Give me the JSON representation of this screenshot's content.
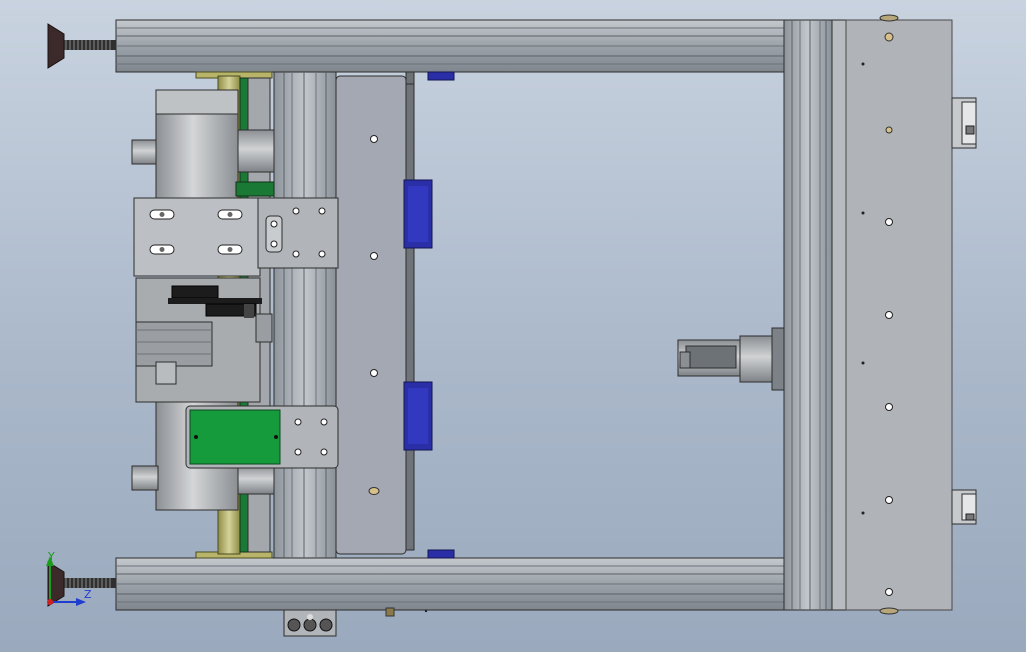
{
  "window": {
    "title": ""
  },
  "viewport": {
    "background_top": "#c9d3e0",
    "background_bottom": "#9aa9bd"
  },
  "triad": {
    "axis_y_label": "Y",
    "axis_z_label": "Z",
    "axis_x_color": "#d02020",
    "axis_y_color": "#1c9c1c",
    "axis_z_color": "#1f3ed0"
  },
  "colors": {
    "extrusion": "#a7adb4",
    "extrusion_dark": "#7d848c",
    "plate": "#b3b6ba",
    "guard_panel": "#8e95a0",
    "blue_pad": "#2a2fa8",
    "green_plate": "#159a3c",
    "rod_yellow": "#b8b56a",
    "motor": "#a9acaf",
    "foot": "#3c2a2a",
    "outline": "#2d2d2d"
  }
}
